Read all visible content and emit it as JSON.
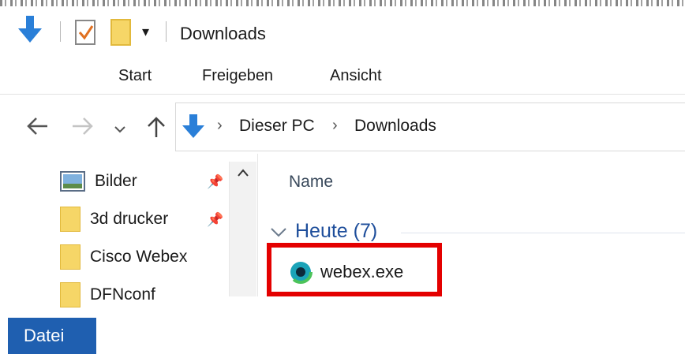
{
  "window": {
    "title": "Downloads"
  },
  "quick_access": {
    "customize_glyph": "▾"
  },
  "ribbon": {
    "tabs": [
      "Datei",
      "Start",
      "Freigeben",
      "Ansicht"
    ]
  },
  "address_bar": {
    "crumbs": [
      "Dieser PC",
      "Downloads"
    ]
  },
  "nav_pane": {
    "items": [
      {
        "label": "Bilder",
        "pinned": true,
        "icon": "pictures-icon"
      },
      {
        "label": "3d drucker",
        "pinned": true,
        "icon": "folder-icon"
      },
      {
        "label": "Cisco Webex",
        "pinned": false,
        "icon": "folder-icon"
      },
      {
        "label": "DFNconf",
        "pinned": false,
        "icon": "folder-icon"
      }
    ]
  },
  "file_list": {
    "column_name": "Name",
    "group_label": "Heute (7)",
    "files": [
      {
        "name": "webex.exe",
        "icon": "webex-app-icon"
      }
    ]
  },
  "colors": {
    "accent": "#1f5fb0",
    "highlight": "#e40000",
    "group_text": "#1e4e9b"
  }
}
